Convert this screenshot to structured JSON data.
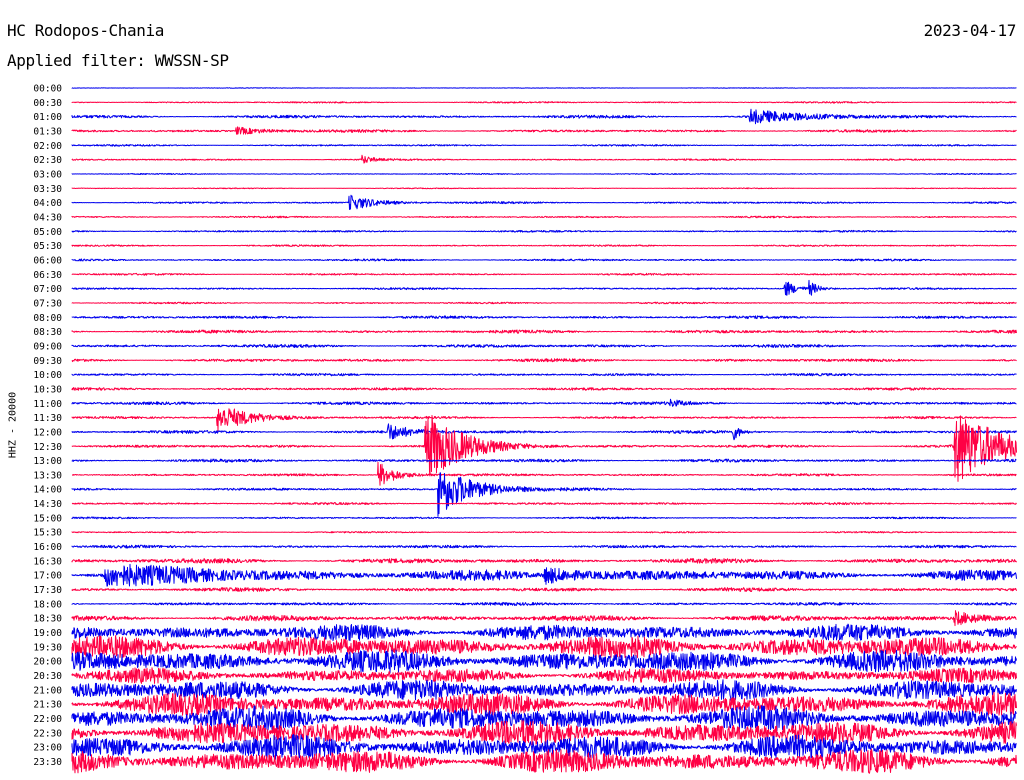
{
  "header": {
    "station": "HC Rodopos-Chania",
    "date": "2023-04-17",
    "filter_label": "Applied filter: WWSSN-SP"
  },
  "colors": {
    "trace_a": "#0000ee",
    "trace_b": "#ff0044"
  },
  "chart_data": {
    "type": "line",
    "title": "HC Rodopos-Chania",
    "ylabel": "HHZ - 20000",
    "x_unit": "minutes within each 30-minute row",
    "xlim": [
      0,
      30
    ],
    "row_labels": [
      "00:00",
      "00:30",
      "01:00",
      "01:30",
      "02:00",
      "02:30",
      "03:00",
      "03:30",
      "04:00",
      "04:30",
      "05:00",
      "05:30",
      "06:00",
      "06:30",
      "07:00",
      "07:30",
      "08:00",
      "08:30",
      "09:00",
      "09:30",
      "10:00",
      "10:30",
      "11:00",
      "11:30",
      "12:00",
      "12:30",
      "13:00",
      "13:30",
      "14:00",
      "14:30",
      "15:00",
      "15:30",
      "16:00",
      "16:30",
      "17:00",
      "17:30",
      "18:00",
      "18:30",
      "19:00",
      "19:30",
      "20:00",
      "20:30",
      "21:00",
      "21:30",
      "22:00",
      "22:30",
      "23:00",
      "23:30"
    ],
    "row_colors": [
      "blue",
      "red"
    ],
    "noise_amplitude": [
      0.3,
      0.8,
      1.6,
      1.4,
      0.9,
      0.9,
      0.6,
      0.5,
      1.0,
      0.9,
      1.0,
      0.9,
      1.1,
      1.0,
      1.0,
      0.9,
      1.5,
      1.7,
      1.7,
      1.6,
      1.3,
      1.4,
      1.6,
      1.2,
      1.6,
      1.5,
      1.6,
      1.3,
      1.3,
      1.2,
      1.0,
      0.8,
      1.5,
      2.5,
      5.5,
      2.0,
      1.6,
      3.0,
      9.0,
      12.0,
      12.0,
      8.0,
      11.0,
      12.0,
      13.0,
      13.0,
      13.0,
      13.0
    ],
    "events": [
      {
        "row": 2,
        "minute": 21.5,
        "amplitude": 7,
        "duration": 3.5
      },
      {
        "row": 3,
        "minute": 5.2,
        "amplitude": 4,
        "duration": 2.0
      },
      {
        "row": 5,
        "minute": 9.2,
        "amplitude": 5,
        "duration": 0.6
      },
      {
        "row": 8,
        "minute": 8.8,
        "amplitude": 8,
        "duration": 1.8
      },
      {
        "row": 14,
        "minute": 22.6,
        "amplitude": 10,
        "duration": 0.8
      },
      {
        "row": 14,
        "minute": 23.4,
        "amplitude": 8,
        "duration": 0.6
      },
      {
        "row": 22,
        "minute": 19.0,
        "amplitude": 3,
        "duration": 1.0
      },
      {
        "row": 23,
        "minute": 4.6,
        "amplitude": 14,
        "duration": 2.2
      },
      {
        "row": 24,
        "minute": 10.0,
        "amplitude": 9,
        "duration": 1.4
      },
      {
        "row": 24,
        "minute": 21.0,
        "amplitude": 9,
        "duration": 0.4
      },
      {
        "row": 25,
        "minute": 11.2,
        "amplitude": 38,
        "duration": 2.4
      },
      {
        "row": 25,
        "minute": 28.0,
        "amplitude": 40,
        "duration": 3.0
      },
      {
        "row": 27,
        "minute": 9.7,
        "amplitude": 14,
        "duration": 1.2
      },
      {
        "row": 28,
        "minute": 11.6,
        "amplitude": 28,
        "duration": 2.2
      },
      {
        "row": 34,
        "minute": 1.0,
        "amplitude": 10,
        "duration": 6.0
      },
      {
        "row": 34,
        "minute": 15.0,
        "amplitude": 8,
        "duration": 3.0
      },
      {
        "row": 37,
        "minute": 28.0,
        "amplitude": 7,
        "duration": 2.0
      }
    ]
  }
}
